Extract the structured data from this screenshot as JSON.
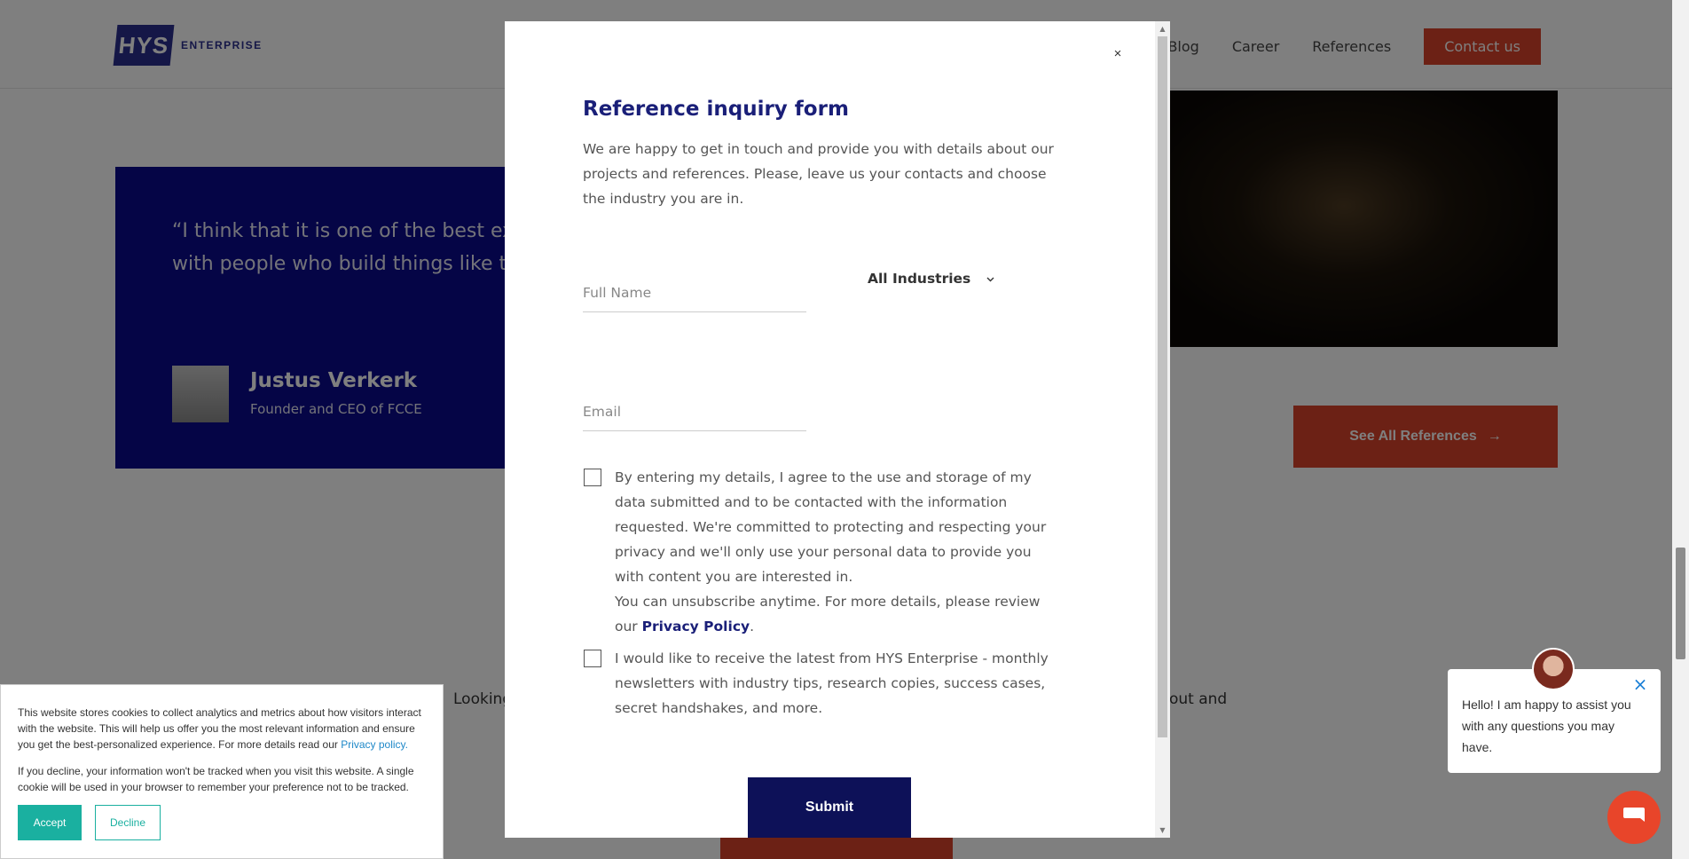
{
  "header": {
    "logo_mark": "HYS",
    "logo_word": "ENTERPRISE",
    "nav": [
      "Blog",
      "Career",
      "References"
    ],
    "contact_label": "Contact us"
  },
  "testimonial": {
    "quote_line1": "“I think that it is one of the best ex",
    "quote_line2": "with people who build things like t",
    "name": "Justus Verkerk",
    "role": "Founder and CEO of FCCE"
  },
  "references_button": {
    "label": "See All References",
    "arrow": "→"
  },
  "looking": {
    "left_text": "Looking",
    "right_text": "out and"
  },
  "modal": {
    "close_glyph": "×",
    "title": "Reference inquiry form",
    "intro": "We are happy to get in touch and provide you with details about our projects and references. Please, leave us your contacts and choose the industry you are in.",
    "full_name_placeholder": "Full Name",
    "email_placeholder": "Email",
    "industry_value": "All Industries",
    "consent_text": "By entering my details, I agree to the use and storage of my data submitted and to be contacted with the information requested. We're committed to protecting and respecting your privacy and we'll only use your personal data to provide you with content you are interested in.",
    "unsubscribe_text": "You can unsubscribe anytime. For more details, please review our ",
    "privacy_link": "Privacy Policy",
    "newsletter_text": "I would like to receive the latest from HYS Enterprise - monthly newsletters with industry tips, research copies, success cases, secret handshakes, and more.",
    "submit_label": "Submit"
  },
  "cookie": {
    "text1": "This website stores cookies to collect analytics and metrics about how visitors interact with the website. This will help us offer you the most relevant information and ensure you get the best-personalized experience. For more details read our ",
    "privacy_link": "Privacy policy.",
    "text2": "If you decline, your information won't be tracked when you visit this website. A single cookie will be used in your browser to remember your preference not to be tracked.",
    "accept_label": "Accept",
    "decline_label": "Decline"
  },
  "chat": {
    "message": "Hello! I am happy to assist you with any questions you may have.",
    "close_glyph": "×"
  },
  "colors": {
    "brand_navy": "#0a0a8c",
    "accent_orange": "#d8432a",
    "submit_navy": "#0d1158",
    "cookie_teal": "#1ab0a0"
  }
}
